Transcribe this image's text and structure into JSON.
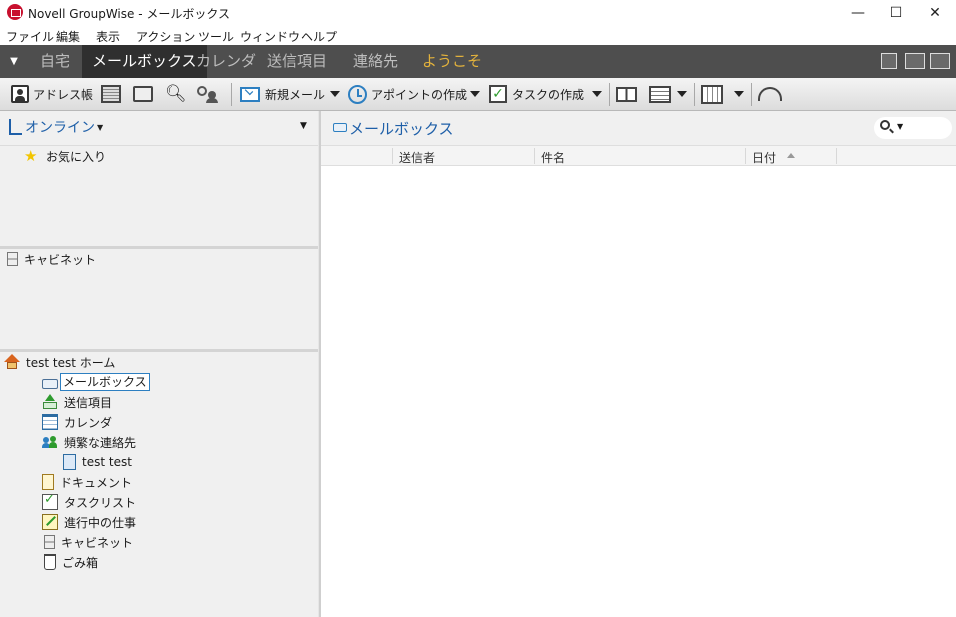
{
  "window": {
    "title": "Novell GroupWise - メールボックス",
    "minimize": "—",
    "maximize": "☐",
    "close": "✕"
  },
  "menu": [
    "ファイル",
    "編集",
    "表示",
    "アクション",
    "ツール",
    "ウィンドウ",
    "ヘルプ"
  ],
  "nav": {
    "tabs": [
      "自宅",
      "メールボックス",
      "カレンダ",
      "送信項目",
      "連絡先",
      "ようこそ"
    ],
    "active": "メールボックス"
  },
  "toolbar": {
    "address_book": "アドレス帳",
    "new_mail": "新規メール",
    "new_appointment": "アポイントの作成",
    "new_task": "タスクの作成"
  },
  "left": {
    "mode": "オンライン",
    "favorites": "お気に入り",
    "cabinet_panel": "キャビネット",
    "home": "test test ホーム",
    "folders": [
      "メールボックス",
      "送信項目",
      "カレンダ",
      "頻繁な連絡先",
      "test test",
      "ドキュメント",
      "タスクリスト",
      "進行中の仕事",
      "キャビネット",
      "ごみ箱"
    ],
    "selected_folder": "メールボックス"
  },
  "right": {
    "title": "メールボックス",
    "columns": [
      "送信者",
      "件名",
      "日付"
    ],
    "sort_column": "日付",
    "sort_direction": "ascending"
  },
  "colors": {
    "nav_bg": "#4e4e4e",
    "nav_active_bg": "#2f2f2f",
    "welcome_text": "#e3b23c",
    "title_blue": "#1e5fa8",
    "logo_red": "#c8102e"
  }
}
